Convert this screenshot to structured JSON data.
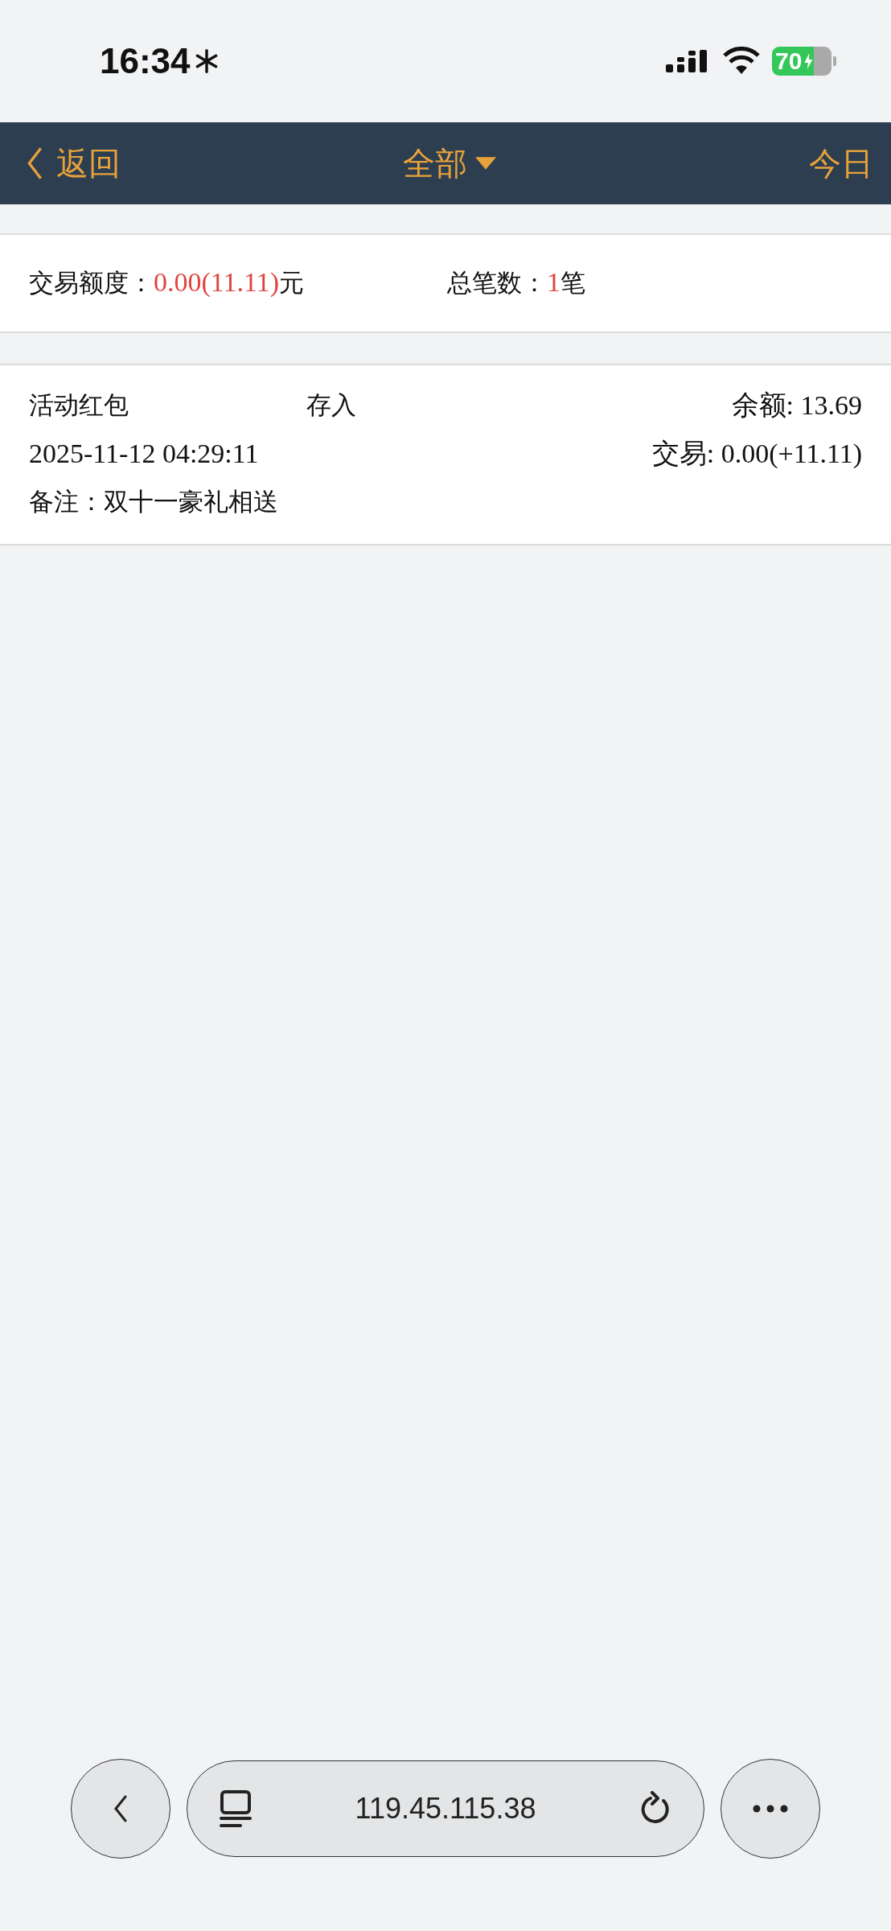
{
  "status_bar": {
    "time": "16:34",
    "battery": "70"
  },
  "nav": {
    "back": "返回",
    "title": "全部",
    "right": "今日"
  },
  "summary": [
    {
      "label": "交易额度：",
      "value": "0.00(11.11)",
      "unit": "元"
    },
    {
      "label": "总笔数：",
      "value": "1",
      "unit": "笔"
    }
  ],
  "records": [
    {
      "name": "活动红包",
      "type": "存入",
      "balance": "余额: 13.69",
      "time": "2025-11-12 04:29:11",
      "amount": "交易: 0.00(+11.11)",
      "note": "备注：双十一豪礼相送"
    }
  ],
  "browser": {
    "url": "119.45.115.38"
  }
}
